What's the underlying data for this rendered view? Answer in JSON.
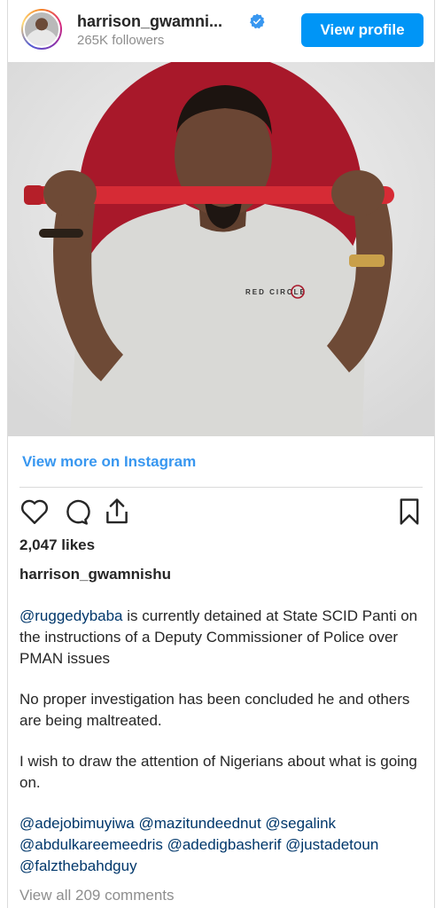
{
  "header": {
    "username": "harrison_gwamni...",
    "followers": "265K followers",
    "view_profile": "View profile"
  },
  "photo": {
    "shirt_text": "RED CIRCLE"
  },
  "view_more": "View more on Instagram",
  "likes": "2,047 likes",
  "post_username": "harrison_gwamnishu",
  "caption": {
    "p1_mention": "@ruggedybaba",
    "p1_text": " is currently detained at State SCID Panti on the instructions of a Deputy Commissioner of Police over PMAN issues",
    "p2": "No proper investigation has been concluded he and others are being maltreated.",
    "p3": "I wish to draw the attention of Nigerians about what is going on.",
    "mentions": [
      "@adejobimuyiwa",
      "@mazitundeednut",
      "@segalink",
      "@abdulkareemeedris",
      "@adedigbasherif",
      "@justadetoun",
      "@falzthebahdguy"
    ]
  },
  "view_comments": "View all 209 comments",
  "colors": {
    "accent": "#0095f6",
    "link": "#3897f0",
    "mention": "#00376b",
    "muted": "#8e8e8e",
    "backdrop_circle": "#a8182a"
  },
  "icons": [
    "verified-badge-icon",
    "heart-icon",
    "comment-icon",
    "share-icon",
    "bookmark-icon"
  ]
}
